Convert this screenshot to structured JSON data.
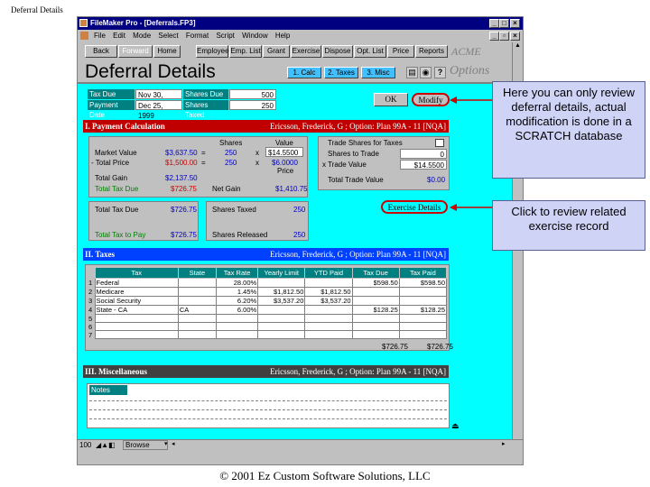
{
  "slide_title": "Deferral Details",
  "footer": "© 2001 Ez Custom Software Solutions, LLC",
  "window": {
    "title": "FileMaker Pro - [Deferrals.FP3]",
    "menu": [
      "File",
      "Edit",
      "Mode",
      "Select",
      "Format",
      "Script",
      "Window",
      "Help"
    ]
  },
  "nav": {
    "buttons": [
      "Back",
      "Forward",
      "Home",
      "Employee",
      "Emp. List",
      "Grant",
      "Exercise",
      "Dispose",
      "Opt. List",
      "Price",
      "Reports"
    ],
    "brand": "ACME"
  },
  "header": {
    "title": "Deferral Details",
    "tabs": [
      "1. Calc",
      "2. Taxes",
      "3. Misc"
    ],
    "options": "Options"
  },
  "dates": {
    "tax_due_label": "Tax Due Date",
    "tax_due_value": "Nov 30, 1999",
    "payment_label": "Payment Date",
    "payment_value": "Dec 25, 1999",
    "shares_due_label": "Shares Due",
    "shares_due_value": "500",
    "shares_taxed_label": "Shares Taxed",
    "shares_taxed_value": "250"
  },
  "buttons": {
    "ok": "OK",
    "modify": "Modify",
    "exercise_details": "Exercise Details"
  },
  "section1": {
    "title": "I. Payment Calculation",
    "person": "Ericsson, Frederick, G ; Option: Plan 99A - 11 [NQA]",
    "col_shares": "Shares",
    "col_value": "Value",
    "col_price": "Price",
    "market_value_label": "Market Value",
    "market_value": "$3,637.50",
    "eq1": "=",
    "shares1": "250",
    "x1": "x",
    "value1": "$14.5500",
    "total_price_label": "- Total Price",
    "total_price": "$1,500.00",
    "eq2": "=",
    "shares2": "250",
    "x2": "x",
    "value2": "$6.0000",
    "total_gain_label": "Total Gain",
    "total_gain": "$2,137.50",
    "total_tax_due_label": "Total Tax Due",
    "total_tax_due": "$726.75",
    "net_gain_label": "Net Gain",
    "net_gain": "$1,410.75",
    "trade_shares_label": "Trade Shares for Taxes",
    "shares_to_trade_label": "Shares to Trade",
    "shares_to_trade": "0",
    "trade_value_label": "x Trade Value",
    "trade_value": "$14.5500",
    "total_trade_value_label": "Total Trade Value",
    "total_trade_value": "$0.00",
    "total_tax_due2_label": "Total Tax Due",
    "total_tax_due2": "$726.75",
    "total_tax_pay_label": "Total Tax to Pay",
    "total_tax_pay": "$726.75",
    "shares_taxed_label": "Shares Taxed",
    "shares_taxed": "250",
    "shares_released_label": "Shares Released",
    "shares_released": "250"
  },
  "section2": {
    "title": "II. Taxes",
    "person": "Ericsson, Frederick, G ; Option: Plan 99A - 11 [NQA]",
    "headers": [
      "Tax",
      "State",
      "Tax Rate",
      "Yearly Limit",
      "YTD Paid",
      "Tax Due",
      "Tax Paid"
    ],
    "rows": [
      {
        "n": "1",
        "tax": "Federal",
        "state": "",
        "rate": "28.00%",
        "limit": "",
        "ytd": "",
        "due": "$598.50",
        "paid": "$598.50"
      },
      {
        "n": "2",
        "tax": "Medicare",
        "state": "",
        "rate": "1.45%",
        "limit": "$1,812.50",
        "ytd": "$1,812.50",
        "due": "",
        "paid": ""
      },
      {
        "n": "3",
        "tax": "Social Security",
        "state": "",
        "rate": "6.20%",
        "limit": "$3,537.20",
        "ytd": "$3,537.20",
        "due": "",
        "paid": ""
      },
      {
        "n": "4",
        "tax": "State - CA",
        "state": "CA",
        "rate": "6.00%",
        "limit": "",
        "ytd": "",
        "due": "$128.25",
        "paid": "$128.25"
      },
      {
        "n": "5",
        "tax": "",
        "state": "",
        "rate": "",
        "limit": "",
        "ytd": "",
        "due": "",
        "paid": ""
      },
      {
        "n": "6",
        "tax": "",
        "state": "",
        "rate": "",
        "limit": "",
        "ytd": "",
        "due": "",
        "paid": ""
      },
      {
        "n": "7",
        "tax": "",
        "state": "",
        "rate": "",
        "limit": "",
        "ytd": "",
        "due": "",
        "paid": ""
      }
    ],
    "total_due": "$726.75",
    "total_paid": "$726.75"
  },
  "section3": {
    "title": "III. Miscellaneous",
    "person": "Ericsson, Frederick, G ; Option: Plan 99A - 11 [NQA]",
    "notes_label": "Notes"
  },
  "status": {
    "zoom": "100",
    "mode": "Browse"
  },
  "callouts": {
    "modify": "Here you can only review deferral details, actual modification is done in a SCRATCH database",
    "exercise": "Click to review related exercise record"
  }
}
